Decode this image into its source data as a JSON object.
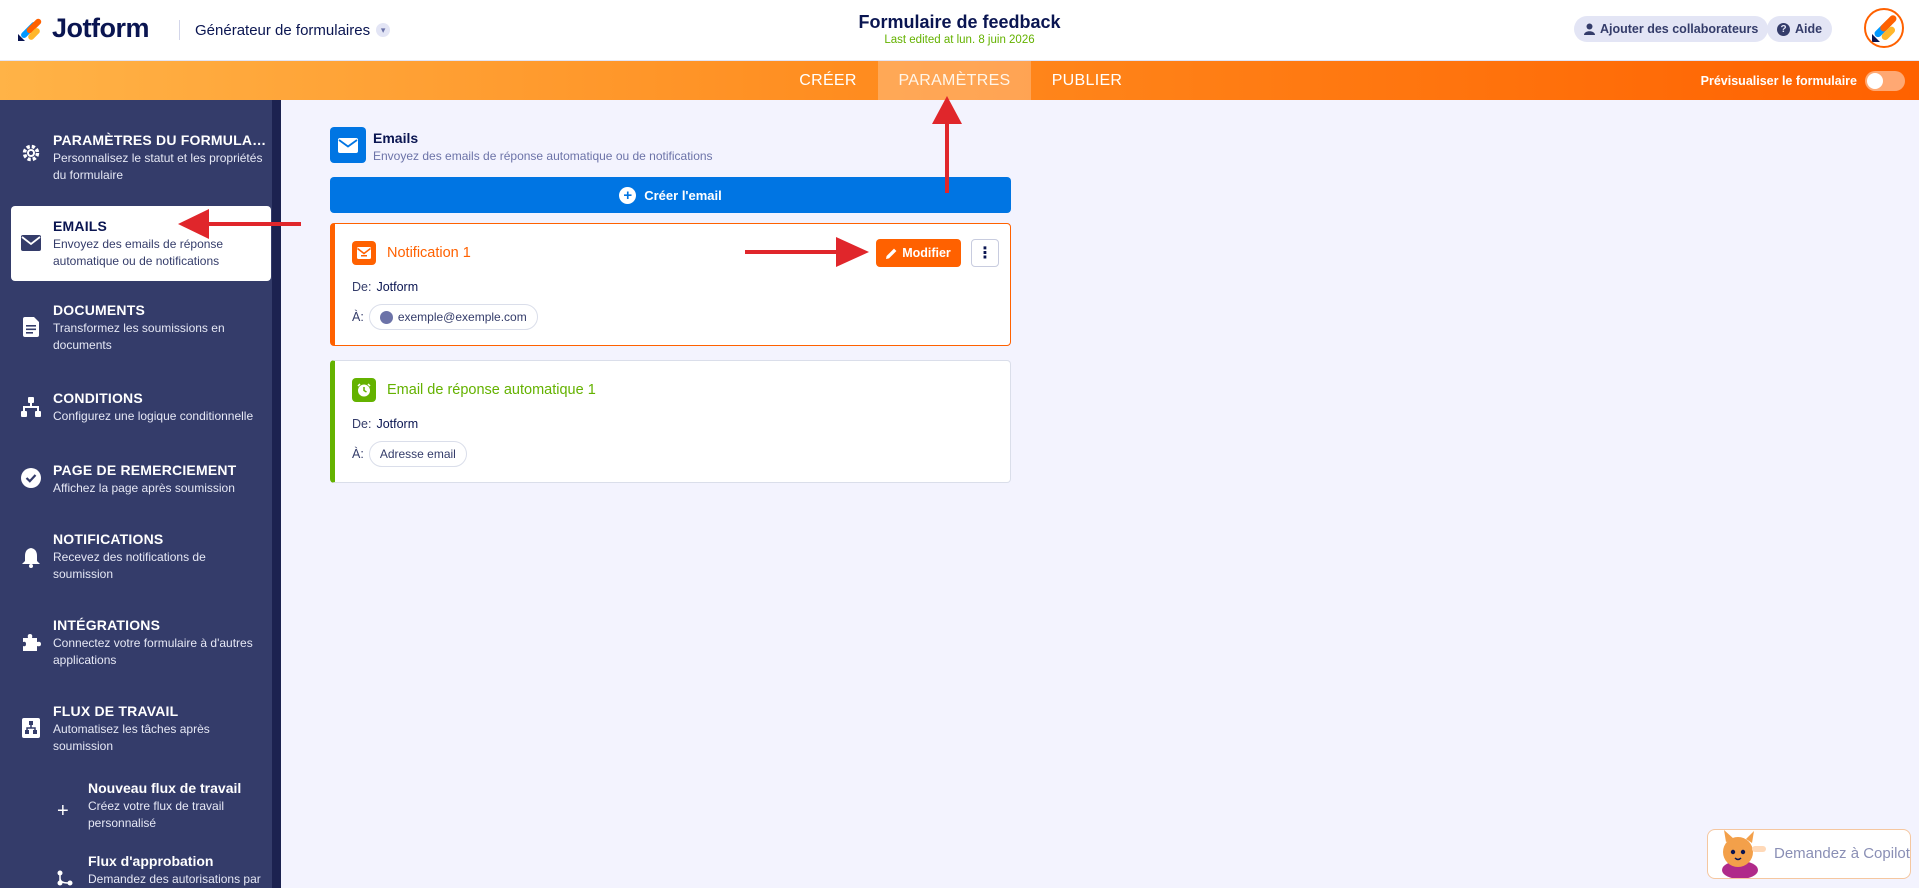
{
  "header": {
    "logo_text": "Jotform",
    "builder_label": "Générateur de formulaires",
    "form_title": "Formulaire de feedback",
    "last_edited": "Last edited at lun. 8 juin 2026",
    "collaborators_label": "Ajouter des collaborateurs",
    "help_label": "Aide"
  },
  "nav": {
    "tabs": [
      {
        "label": "CRÉER"
      },
      {
        "label": "PARAMÈTRES"
      },
      {
        "label": "PUBLIER"
      }
    ],
    "active_tab": "PARAMÈTRES",
    "preview_label": "Prévisualiser le formulaire"
  },
  "sidebar": {
    "items": [
      {
        "title": "PARAMÈTRES DU FORMULAI...",
        "desc": "Personnalisez le statut et les propriétés du formulaire",
        "icon": "gear-icon"
      },
      {
        "title": "EMAILS",
        "desc": "Envoyez des emails de réponse automatique ou de notifications",
        "icon": "envelope-icon"
      },
      {
        "title": "DOCUMENTS",
        "desc": "Transformez les soumissions en documents",
        "icon": "document-icon"
      },
      {
        "title": "CONDITIONS",
        "desc": "Configurez une logique conditionnelle",
        "icon": "sitemap-icon"
      },
      {
        "title": "PAGE DE REMERCIEMENT",
        "desc": "Affichez la page après soumission",
        "icon": "check-circle-icon"
      },
      {
        "title": "NOTIFICATIONS",
        "desc": "Recevez des notifications de soumission",
        "icon": "bell-icon"
      },
      {
        "title": "INTÉGRATIONS",
        "desc": "Connectez votre formulaire à d'autres applications",
        "icon": "puzzle-icon"
      },
      {
        "title": "FLUX DE TRAVAIL",
        "desc": "Automatisez les tâches après soumission",
        "icon": "workflow-icon"
      }
    ],
    "sub_items": [
      {
        "title": "Nouveau flux de travail",
        "desc": "Créez votre flux de travail personnalisé",
        "icon": "plus-icon"
      },
      {
        "title": "Flux d'approbation",
        "desc": "Demandez des autorisations par",
        "icon": "approval-flow-icon"
      }
    ],
    "active_item": "EMAILS"
  },
  "main": {
    "section_title": "Emails",
    "section_desc": "Envoyez des emails de réponse automatique ou de notifications",
    "create_button": "Créer l'email",
    "cards": [
      {
        "title": "Notification 1",
        "from_label": "De:",
        "from_value": "Jotform",
        "to_label": "À:",
        "to_value": "exemple@exemple.com",
        "edit_label": "Modifier",
        "accent": "#ff6100"
      },
      {
        "title": "Email de réponse automatique 1",
        "from_label": "De:",
        "from_value": "Jotform",
        "to_label": "À:",
        "to_value": "Adresse email",
        "accent": "#64b200"
      }
    ]
  },
  "copilot": {
    "label": "Demandez à Copilot"
  },
  "colors": {
    "brand_orange": "#ff6100",
    "brand_blue": "#0075e3",
    "brand_green": "#64b200",
    "sidebar_bg": "#343c6a",
    "annotation_red": "#e0262b"
  }
}
